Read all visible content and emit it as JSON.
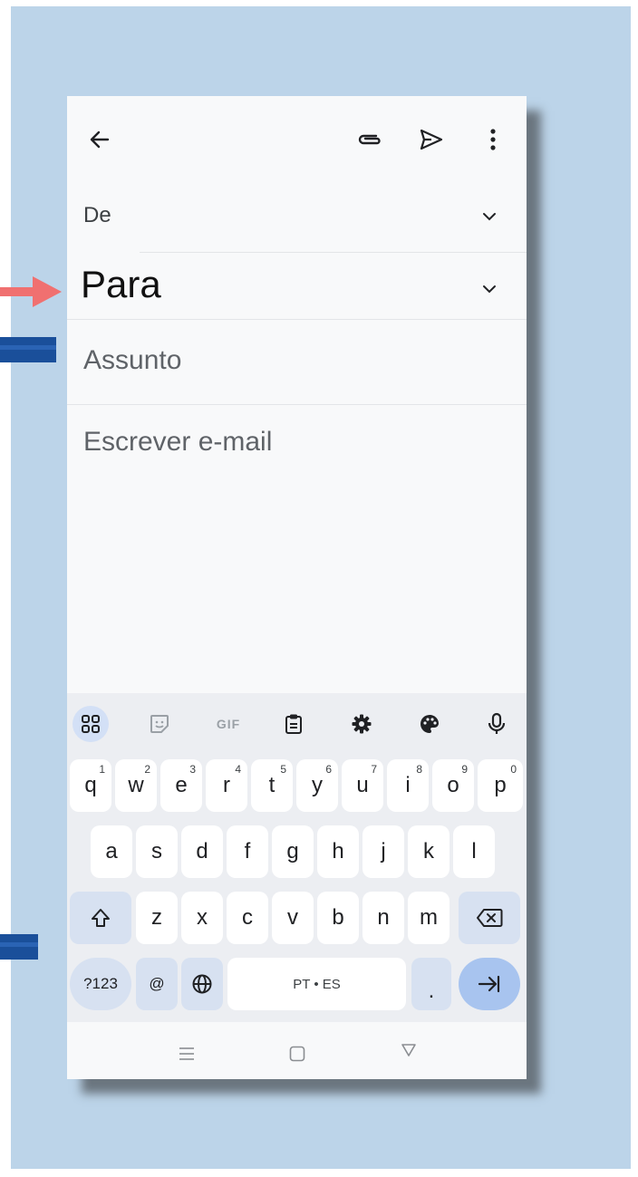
{
  "header": {
    "back_icon": "arrow-left-icon",
    "attach_icon": "paperclip-icon",
    "send_icon": "send-icon",
    "more_icon": "more-vertical-icon"
  },
  "form": {
    "from_label": "De",
    "to_label": "Para",
    "subject_placeholder": "Assunto",
    "body_placeholder": "Escrever e-mail"
  },
  "keyboard": {
    "toolbar": [
      "apps-grid-icon",
      "sticker-icon",
      "GIF",
      "clipboard-icon",
      "settings-icon",
      "palette-icon",
      "microphone-icon"
    ],
    "row1": [
      {
        "key": "q",
        "sup": "1"
      },
      {
        "key": "w",
        "sup": "2"
      },
      {
        "key": "e",
        "sup": "3"
      },
      {
        "key": "r",
        "sup": "4"
      },
      {
        "key": "t",
        "sup": "5"
      },
      {
        "key": "y",
        "sup": "6"
      },
      {
        "key": "u",
        "sup": "7"
      },
      {
        "key": "i",
        "sup": "8"
      },
      {
        "key": "o",
        "sup": "9"
      },
      {
        "key": "p",
        "sup": "0"
      }
    ],
    "row2": [
      "a",
      "s",
      "d",
      "f",
      "g",
      "h",
      "j",
      "k",
      "l"
    ],
    "row3": [
      "z",
      "x",
      "c",
      "v",
      "b",
      "n",
      "m"
    ],
    "symbols_label": "?123",
    "at_label": "@",
    "space_label": "PT • ES",
    "period_label": ".",
    "shift_icon": "shift-icon",
    "backspace_icon": "backspace-icon",
    "globe_icon": "globe-icon",
    "enter_icon": "tab-right-icon"
  },
  "navbar": {
    "items": [
      "recent-apps-icon",
      "home-icon",
      "back-triangle-icon"
    ]
  },
  "colors": {
    "background": "#bcd4e9",
    "arrow": "#f07070",
    "accent_blue": "#1a4f9a",
    "enter_key": "#a8c4ef"
  }
}
